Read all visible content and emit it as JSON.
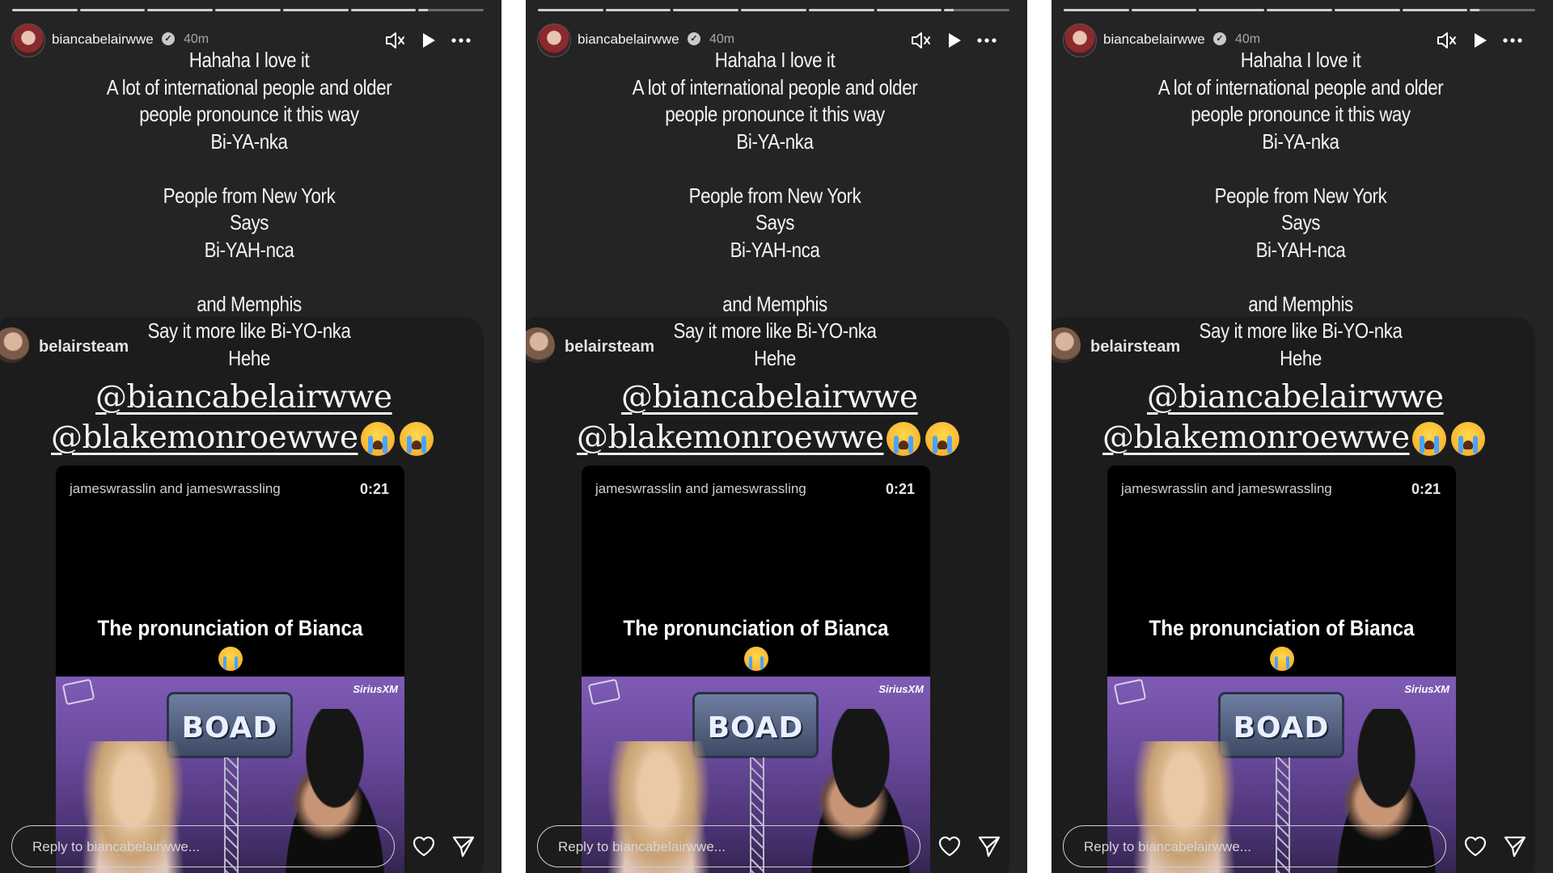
{
  "colors": {
    "panel_bg": "#242424",
    "text": "#f3f3f3",
    "muted": "#a7a7a7",
    "video_bg": "#000000",
    "studio": "#7f5bb5"
  },
  "story": {
    "username": "biancabelairwwe",
    "time": "40m",
    "progress": {
      "segments": 7,
      "completed": 6,
      "active_fraction": 0.15
    },
    "controls": {
      "mute_icon": "speaker-muted-icon",
      "play_icon": "play-icon",
      "more_icon": "more-icon"
    },
    "caption": [
      "Hahaha I love it",
      "A lot of international people and older",
      "people pronounce it this way",
      "Bi-YA-nka",
      "",
      "People from New York",
      "Says",
      "Bi-YAH-nca",
      "",
      "and Memphis",
      "Say it more like  Bi-YO-nka",
      "Hehe"
    ],
    "shared_post": {
      "username": "belairsteam",
      "mention_1": "@biancabelairwwe",
      "mention_2": "@blakemonroewwe",
      "video": {
        "channel": "jameswrasslin and jameswrassling",
        "duration": "0:21",
        "title": "The pronunciation of Bianca",
        "board_text": "BOAD",
        "brand": "SiriusXM"
      }
    },
    "reply_placeholder": "Reply to biancabelairwwe...",
    "heart_icon": "heart-icon",
    "send_icon": "send-icon"
  }
}
